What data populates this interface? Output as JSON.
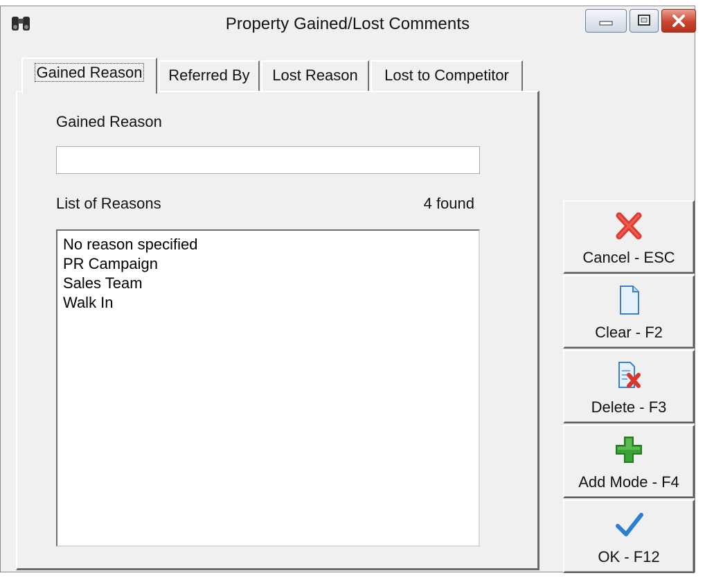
{
  "window": {
    "title": "Property Gained/Lost Comments",
    "icons": {
      "app": "binoculars-icon",
      "minimize": "minimize-icon",
      "maximize": "maximize-icon",
      "close": "close-icon"
    }
  },
  "tabs": [
    {
      "label": "Gained Reason",
      "active": true
    },
    {
      "label": "Referred By",
      "active": false
    },
    {
      "label": "Lost Reason",
      "active": false
    },
    {
      "label": "Lost to Competitor",
      "active": false
    }
  ],
  "form": {
    "field_label": "Gained Reason",
    "field_value": "",
    "list_label": "List of Reasons",
    "list_count": "4 found",
    "items": [
      "No reason specified",
      "PR Campaign",
      "Sales Team",
      "Walk In"
    ]
  },
  "actions": [
    {
      "label": "Cancel - ESC",
      "icon": "red-x-icon"
    },
    {
      "label": "Clear - F2",
      "icon": "blank-document-icon"
    },
    {
      "label": "Delete - F3",
      "icon": "delete-document-icon"
    },
    {
      "label": "Add Mode - F4",
      "icon": "green-plus-icon"
    },
    {
      "label": "OK - F12",
      "icon": "blue-checkmark-icon"
    }
  ],
  "colors": {
    "close_button": "#c8452f",
    "plus_green": "#3aa335",
    "check_blue": "#2a7fd4",
    "x_red": "#e23a2e"
  }
}
